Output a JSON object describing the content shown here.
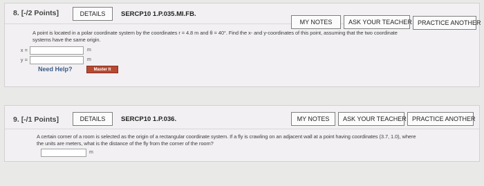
{
  "question8": {
    "number": "8.",
    "points": "[-/2 Points]",
    "details_label": "DETAILS",
    "code": "SERCP10 1.P.035.MI.FB.",
    "my_notes_label": "MY NOTES",
    "ask_teacher_label": "ASK YOUR TEACHER",
    "practice_label": "PRACTICE ANOTHER",
    "text_line1": "A point is located in a polar coordinate system by the coordinates r = 4.8 m and θ = 40°. Find the x- and y-coordinates of this point, assuming that the two coordinate",
    "text_line2": "systems have the same origin.",
    "x_label": "x =",
    "y_label": "y =",
    "x_value": "",
    "y_value": "",
    "x_unit": "m",
    "y_unit": "m",
    "need_help_label": "Need Help?",
    "master_it_label": "Master It"
  },
  "question9": {
    "number": "9.",
    "points": "[-/1 Points]",
    "details_label": "DETAILS",
    "code": "SERCP10 1.P.036.",
    "my_notes_label": "MY NOTES",
    "ask_teacher_label": "ASK YOUR TEACHER",
    "practice_label": "PRACTICE ANOTHER",
    "text_line1": "A certain corner of a room is selected as the origin of a rectangular coordinate system. If a fly is crawling on an adjacent wall at a point having coordinates (3.7, 1.0), where",
    "text_line2": "the units are meters, what is the distance of the fly from the corner of the room?",
    "answer_value": "",
    "answer_unit": "m"
  }
}
